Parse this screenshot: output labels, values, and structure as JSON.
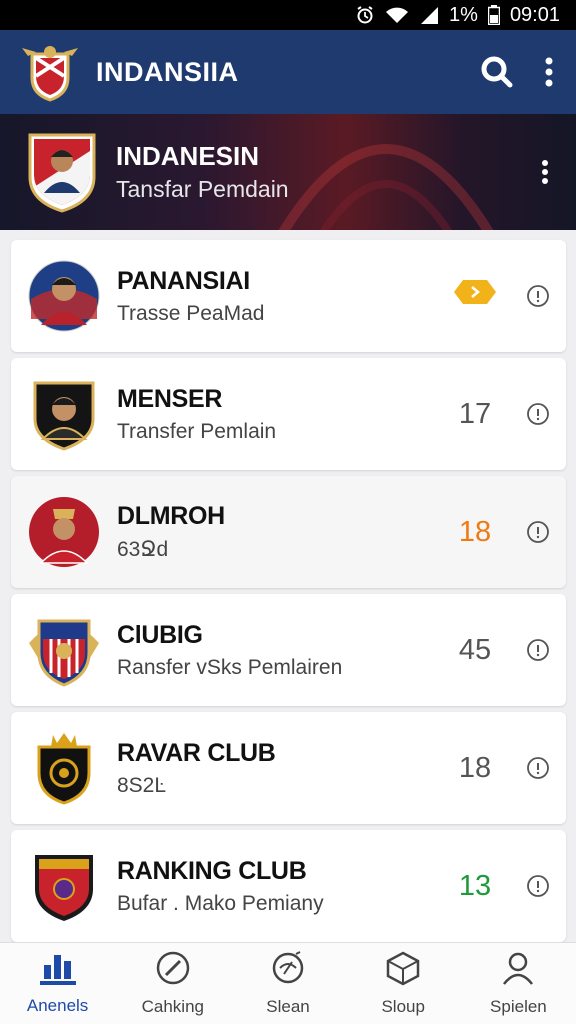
{
  "status_bar": {
    "battery": "1%",
    "time": "09:01"
  },
  "app_bar": {
    "title": "INDANSIIA"
  },
  "hero": {
    "title": "INDANESIN",
    "subtitle": "Tansfar Pemdain"
  },
  "cards": [
    {
      "title": "PANANSIAI",
      "subtitle": "Trasse PeaMad",
      "count": "",
      "count_color": "#f2b21a"
    },
    {
      "title": "MENSER",
      "subtitle": "Transfer Pemlain",
      "count": "17",
      "count_color": "#555555"
    },
    {
      "title": "DLMROH",
      "subtitle": "63Ջd",
      "count": "18",
      "count_color": "#f07a12"
    },
    {
      "title": "ClUBIG",
      "subtitle": "Ransfer vSks Pemlairen",
      "count": "45",
      "count_color": "#555555"
    },
    {
      "title": "RAVAR CLUB",
      "subtitle": "8S2Ŀ",
      "count": "18",
      "count_color": "#555555"
    },
    {
      "title": "RANKING CLUB",
      "subtitle": "Bufar . Mako Pemiany",
      "count": "13",
      "count_color": "#1f9a3a"
    }
  ],
  "bottom_nav": [
    {
      "label": "Anenels",
      "icon": "bar-chart-icon",
      "active": true
    },
    {
      "label": "Cahking",
      "icon": "compass-icon",
      "active": false
    },
    {
      "label": "Slean",
      "icon": "ball-icon",
      "active": false
    },
    {
      "label": "Sloup",
      "icon": "box-icon",
      "active": false
    },
    {
      "label": "Spielen",
      "icon": "person-icon",
      "active": false
    }
  ],
  "colors": {
    "app_bar": "#1f3a6e",
    "accent": "#1e4aa8",
    "badge": "#f2b21a"
  }
}
